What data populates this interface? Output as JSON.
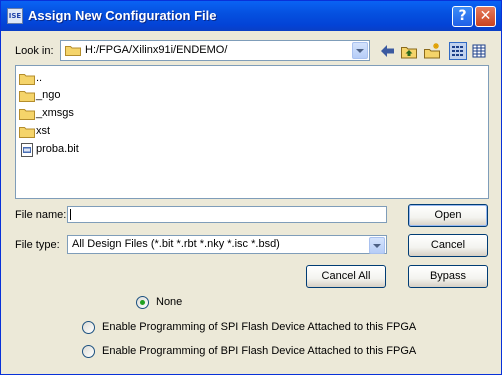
{
  "window": {
    "title": "Assign New Configuration File",
    "app_icon_text": "ISE",
    "help_label": "?",
    "close_label": "✕"
  },
  "lookin": {
    "label": "Look in:",
    "value": "H:/FPGA/Xilinx91i/ENDEMO/"
  },
  "toolbar_icons": [
    "back-arrow-icon",
    "up-folder-icon",
    "new-folder-icon",
    "list-view-icon",
    "details-view-icon"
  ],
  "files": [
    {
      "name": "..",
      "icon": "folder-icon"
    },
    {
      "name": "_ngo",
      "icon": "folder-icon"
    },
    {
      "name": "_xmsgs",
      "icon": "folder-icon"
    },
    {
      "name": "xst",
      "icon": "folder-icon"
    },
    {
      "name": "proba.bit",
      "icon": "bit-file-icon"
    }
  ],
  "filename": {
    "label": "File name:",
    "value": ""
  },
  "filetype": {
    "label": "File type:",
    "value": "All Design Files (*.bit *.rbt *.nky *.isc *.bsd)"
  },
  "buttons": {
    "open": "Open",
    "cancel": "Cancel",
    "cancel_all": "Cancel All",
    "bypass": "Bypass"
  },
  "radio_options": [
    {
      "label": "None",
      "checked": true
    },
    {
      "label": "Enable Programming of SPI Flash Device Attached to this FPGA",
      "checked": false
    },
    {
      "label": "Enable Programming of BPI Flash Device Attached to this FPGA",
      "checked": false
    }
  ],
  "colors": {
    "titlebar": "#0551e0",
    "dialog_bg": "#ece9d8",
    "folder": "#f5d46a",
    "radio_dot": "#21a121"
  }
}
